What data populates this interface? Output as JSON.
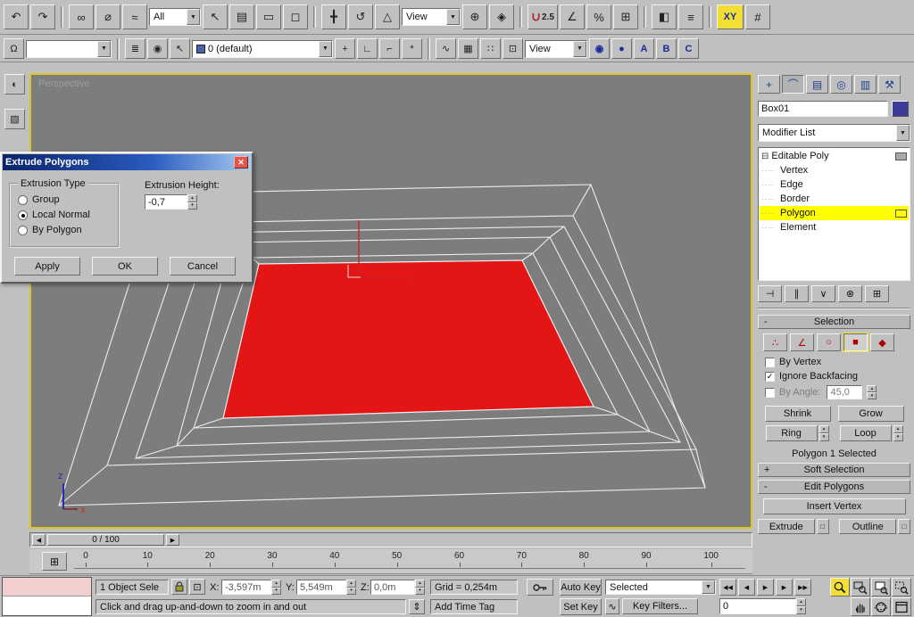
{
  "ui": {
    "spin_up": "▴",
    "spin_down": "▾",
    "combo_arrow": "▼",
    "check": "✓",
    "minus_box": "⊟",
    "arrow_left": "◀",
    "arrow_right": "▶",
    "settings_box": "□"
  },
  "colors": {
    "ui_gray": "#c0c0c0",
    "viewport_gray": "#7d7d7d",
    "active_viewport_border": "#ddc71e",
    "selection_red": "#e31515",
    "stack_highlight": "#ffff00",
    "title_blue": "#0a246a"
  },
  "toolbar1": {
    "filter_value": "All",
    "coord_value": "View",
    "snap_label": "2.5",
    "xy_label": "XY",
    "group_a": [
      {
        "n": "undo-icon",
        "g": "↶"
      },
      {
        "n": "redo-icon",
        "g": "↷"
      }
    ],
    "group_b": [
      {
        "n": "select-and-link-icon",
        "g": "∞"
      },
      {
        "n": "unlink-selection-icon",
        "g": "⌀"
      },
      {
        "n": "bind-to-space-warp-icon",
        "g": "≈"
      }
    ],
    "group_c": [
      {
        "n": "select-object-icon",
        "g": "↖"
      },
      {
        "n": "select-by-name-icon",
        "g": "▤"
      },
      {
        "n": "rectangular-selection-region-icon",
        "g": "▭"
      },
      {
        "n": "window-crossing-toggle-icon",
        "g": "◻"
      }
    ],
    "group_d": [
      {
        "n": "select-and-move-icon",
        "g": "╋"
      },
      {
        "n": "select-and-rotate-icon",
        "g": "↺"
      },
      {
        "n": "select-and-uniform-scale-icon",
        "g": "△"
      }
    ],
    "group_e": [
      {
        "n": "use-pivot-point-center-icon",
        "g": "⊕"
      },
      {
        "n": "select-and-manipulate-icon",
        "g": "◈"
      }
    ],
    "group_f": [
      {
        "n": "angle-snap-toggle-icon",
        "g": "∠"
      },
      {
        "n": "percent-snap-toggle-icon",
        "g": "%"
      },
      {
        "n": "spinner-snap-toggle-icon",
        "g": "⊞"
      }
    ],
    "group_g": [
      {
        "n": "mirror-icon",
        "g": "◧"
      },
      {
        "n": "align-icon",
        "g": "≡"
      }
    ],
    "group_h": [
      {
        "n": "grid-snap-icon",
        "g": "#"
      }
    ]
  },
  "toolbar2": {
    "named_selection_value": "",
    "layer_value": "0 (default)",
    "render_view_value": "View",
    "abc": [
      "A",
      "B",
      "C"
    ],
    "group_a": [
      {
        "n": "keyboard-override-toggle-icon",
        "g": "Ω"
      }
    ],
    "group_b": [
      {
        "n": "layer-manager-icon",
        "g": "≣"
      },
      {
        "n": "layer-display-toggle-icon",
        "g": "◉"
      },
      {
        "n": "select-objects-in-layer-icon",
        "g": "↖"
      }
    ],
    "group_c": [
      {
        "n": "create-new-layer-icon",
        "g": "+"
      },
      {
        "n": "add-selection-to-layer-icon",
        "g": "∟"
      },
      {
        "n": "set-current-layer-icon",
        "g": "⌐"
      },
      {
        "n": "isolate-selection-icon",
        "g": "*"
      }
    ],
    "group_d": [
      {
        "n": "curve-editor-icon",
        "g": "∿"
      },
      {
        "n": "schematic-view-icon",
        "g": "▦"
      },
      {
        "n": "material-editor-icon",
        "g": "∷"
      },
      {
        "n": "render-setup-icon",
        "g": "⊡"
      }
    ],
    "group_e": [
      {
        "n": "render-type-icon",
        "g": "◉"
      },
      {
        "n": "quick-render-icon",
        "g": "●"
      }
    ]
  },
  "left_strip": [
    {
      "n": "asset-browser-icon",
      "g": "◐"
    },
    {
      "n": "chart-utility-icon",
      "g": "▧"
    }
  ],
  "viewport": {
    "label": "Perspective",
    "axis_x": "x",
    "axis_z": "z",
    "gizmo_x_label": "x"
  },
  "dialog": {
    "title": "Extrude Polygons",
    "close_glyph": "✕",
    "group_label": "Extrusion Type",
    "options": [
      "Group",
      "Local Normal",
      "By Polygon"
    ],
    "selected_option": "Local Normal",
    "height_label": "Extrusion Height:",
    "height_value": "-0,7",
    "apply_label": "Apply",
    "ok_label": "OK",
    "cancel_label": "Cancel"
  },
  "panel": {
    "tabs": [
      {
        "n": "tab-create-icon",
        "g": "+",
        "cls": "ptab"
      },
      {
        "n": "tab-modify-icon",
        "g": "⌒",
        "cls": "ptab pressed"
      },
      {
        "n": "tab-hierarchy-icon",
        "g": "▤",
        "cls": "ptab"
      },
      {
        "n": "tab-motion-icon",
        "g": "◎",
        "cls": "ptab"
      },
      {
        "n": "tab-display-icon",
        "g": "▥",
        "cls": "ptab"
      },
      {
        "n": "tab-utilities-icon",
        "g": "⚒",
        "cls": "ptab"
      }
    ],
    "object_name": "Box01",
    "modifier_list_value": "Modifier List",
    "stack_root": "Editable Poly",
    "stack_items": [
      "Vertex",
      "Edge",
      "Border",
      "Polygon",
      "Element"
    ],
    "stack_selected": "Polygon",
    "stack_buttons": [
      {
        "n": "pin-stack-icon",
        "g": "⊣"
      },
      {
        "n": "show-end-result-icon",
        "g": "∥"
      },
      {
        "n": "make-unique-icon",
        "g": "∨"
      },
      {
        "n": "remove-modifier-icon",
        "g": "⊗"
      },
      {
        "n": "configure-modifier-sets-icon",
        "g": "⊞"
      }
    ],
    "collapse_glyph": "-",
    "expand_glyph": "+",
    "selection_header": "Selection",
    "subobject_icons": [
      {
        "n": "vertex-mode-icon",
        "g": "∴",
        "cls": "btn sob"
      },
      {
        "n": "edge-mode-icon",
        "g": "∠",
        "cls": "btn sob"
      },
      {
        "n": "border-mode-icon",
        "g": "○",
        "cls": "btn sob"
      },
      {
        "n": "polygon-mode-icon",
        "g": "■",
        "cls": "btn sob active"
      },
      {
        "n": "element-mode-icon",
        "g": "◆",
        "cls": "btn sob"
      }
    ],
    "by_vertex": "By Vertex",
    "ignore_backfacing": "Ignore Backfacing",
    "by_angle": "By Angle:",
    "angle_value": "45,0",
    "shrink": "Shrink",
    "grow": "Grow",
    "ring": "Ring",
    "loop": "Loop",
    "selection_status": "Polygon 1 Selected",
    "soft_selection_header": "Soft Selection",
    "edit_polygons_header": "Edit Polygons",
    "insert_vertex": "Insert Vertex",
    "extrude": "Extrude",
    "outline": "Outline"
  },
  "timeline": {
    "slider_label": "0 / 100",
    "ticks": [
      "0",
      "10",
      "20",
      "30",
      "40",
      "50",
      "60",
      "70",
      "80",
      "90",
      "100"
    ]
  },
  "status": {
    "selection_status": "1 Object Sele",
    "x_label": "X:",
    "x_value": "-3,597m",
    "y_label": "Y:",
    "y_value": "5,549m",
    "z_label": "Z:",
    "z_value": "0,0m",
    "grid_value": "Grid = 0,254m",
    "prompt": "Click and drag up-and-down to zoom in and out",
    "add_time_tag": "Add Time Tag",
    "auto_key": "Auto Key",
    "set_key": "Set Key",
    "selected_value": "Selected",
    "key_filters": "Key Filters...",
    "wave_glyph": "∿",
    "drag_glyph": "⇕",
    "time_value": "0",
    "playback": [
      {
        "n": "go-to-start-icon",
        "g": "◀◀"
      },
      {
        "n": "previous-frame-icon",
        "g": "◀"
      },
      {
        "n": "play-animation-icon",
        "g": "▶"
      },
      {
        "n": "next-frame-icon",
        "g": "▶"
      },
      {
        "n": "go-to-end-icon",
        "g": "▶▶"
      }
    ]
  }
}
